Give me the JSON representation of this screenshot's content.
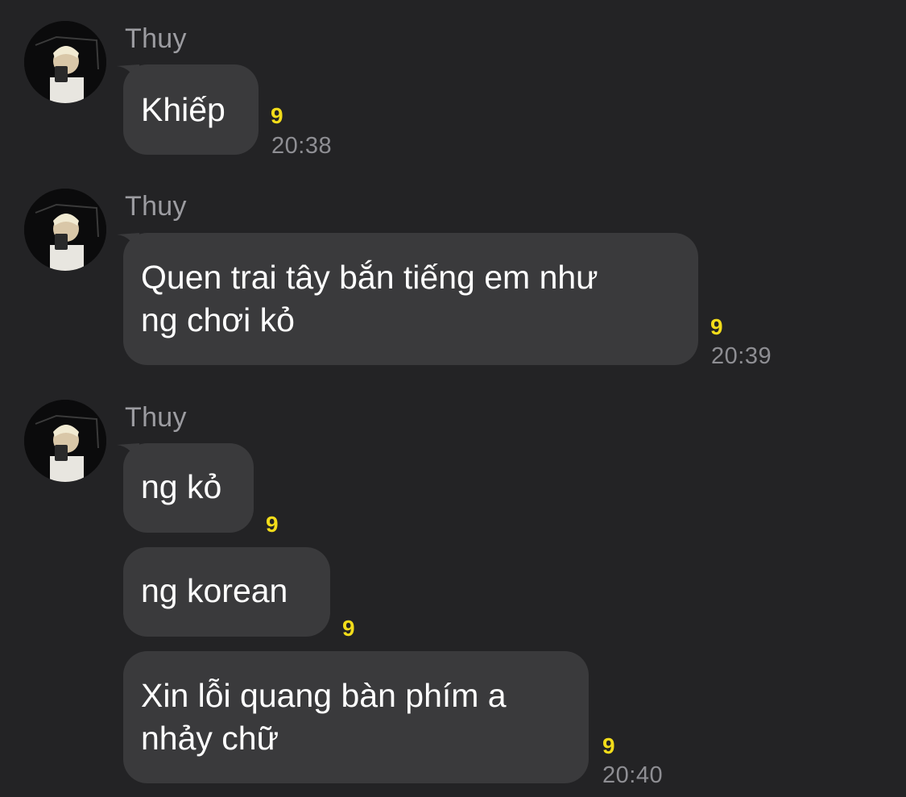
{
  "groups": [
    {
      "sender": "Thuy",
      "messages": [
        {
          "text": "Khiếp",
          "read_count": "9"
        }
      ],
      "time": "20:38"
    },
    {
      "sender": "Thuy",
      "messages": [
        {
          "line1": "Quen trai tây bắn tiếng em như",
          "line2": "ng chơi kỏ",
          "read_count": "9"
        }
      ],
      "time": "20:39"
    },
    {
      "sender": "Thuy",
      "messages": [
        {
          "text": "ng kỏ",
          "read_count": "9"
        },
        {
          "text": "ng korean",
          "read_count": "9"
        },
        {
          "line1": "Xin lỗi quang bàn phím a",
          "line2": "nhảy chữ",
          "read_count": "9"
        }
      ],
      "time": "20:40"
    }
  ],
  "colors": {
    "background": "#232325",
    "bubble": "#3a3a3c",
    "read_count": "#f2dc1a",
    "timestamp": "#8e8e93",
    "sender_name": "#9c9ca1"
  }
}
